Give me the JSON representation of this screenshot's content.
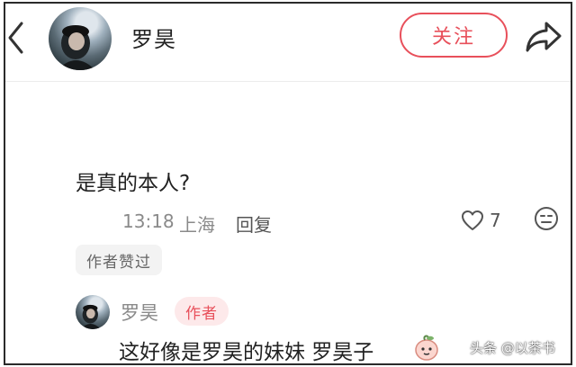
{
  "header": {
    "username": "罗昊",
    "follow_label": "关注"
  },
  "comment": {
    "text": "是真的本人?",
    "time": "13:18",
    "location": "上海",
    "reply_label": "回复",
    "like_count": "7",
    "author_liked_label": "作者赞过"
  },
  "reply": {
    "username": "罗昊",
    "badge": "作者",
    "text": "这好像是罗昊的妹妹 罗昊子"
  },
  "watermark": "头条 @以茶书",
  "colors": {
    "accent": "#e8505b",
    "badge_bg": "#fde9ea",
    "meta_text": "#8a8a8a"
  },
  "icons": [
    "back-chevron-icon",
    "share-arrow-icon",
    "heart-icon",
    "emoji-icon",
    "peach-emoji-icon"
  ]
}
